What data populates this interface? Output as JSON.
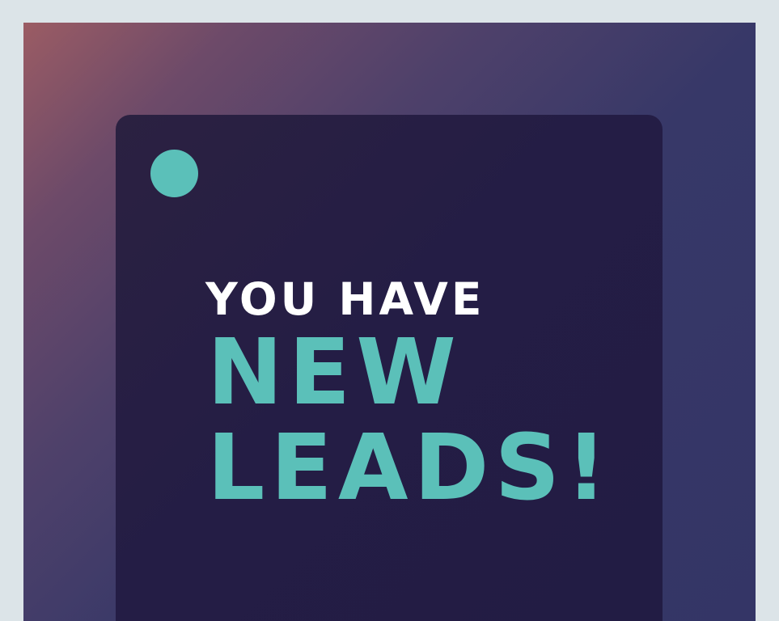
{
  "headline": {
    "line1": "YOU HAVE",
    "line2": "NEW",
    "line3": "LEADS!"
  },
  "colors": {
    "frame": "#dce4e8",
    "card": "#241d45",
    "accent": "#5bc0b9",
    "headline_primary": "#ffffff",
    "gradient_start": "#9b5c64",
    "gradient_end": "#343566"
  },
  "icons": {
    "status": "teal-dot-icon"
  }
}
